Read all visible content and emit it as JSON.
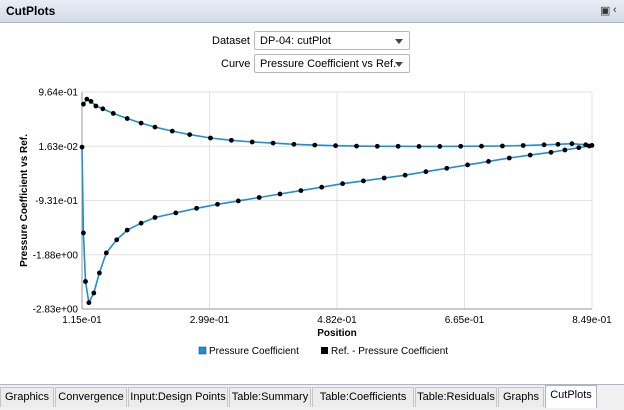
{
  "window": {
    "title": "CutPlots"
  },
  "controls": {
    "dataset_label": "Dataset",
    "dataset_value": "DP-04: cutPlot",
    "curve_label": "Curve",
    "curve_value": "Pressure Coefficient vs Ref."
  },
  "tabs": [
    {
      "label": "Graphics"
    },
    {
      "label": "Convergence"
    },
    {
      "label": "Input:Design Points"
    },
    {
      "label": "Table:Summary"
    },
    {
      "label": "Table:Coefficients"
    },
    {
      "label": "Table:Residuals"
    },
    {
      "label": "Graphs"
    },
    {
      "label": "CutPlots",
      "active": true
    }
  ],
  "chart_data": {
    "type": "line",
    "xlabel": "Position",
    "ylabel": "Pressure Coefficient vs Ref.",
    "xlim": [
      0.115,
      0.849
    ],
    "ylim": [
      -2.83,
      0.964
    ],
    "x_ticks": [
      "1.15e-01",
      "2.99e-01",
      "4.82e-01",
      "6.65e-01",
      "8.49e-01"
    ],
    "y_ticks": [
      "9.64e-01",
      "1.63e-02",
      "-9.31e-01",
      "-1.88e+00",
      "-2.83e+00"
    ],
    "grid": true,
    "legend_position": "bottom",
    "series": [
      {
        "name": "Pressure Coefficient",
        "color": "#1e8fd0",
        "style": "line",
        "x": [
          0.117,
          0.122,
          0.128,
          0.135,
          0.145,
          0.16,
          0.18,
          0.2,
          0.22,
          0.245,
          0.27,
          0.3,
          0.33,
          0.36,
          0.39,
          0.42,
          0.45,
          0.48,
          0.51,
          0.54,
          0.57,
          0.6,
          0.63,
          0.66,
          0.69,
          0.72,
          0.75,
          0.78,
          0.8,
          0.82,
          0.84,
          0.849,
          0.845,
          0.83,
          0.81,
          0.79,
          0.76,
          0.73,
          0.7,
          0.67,
          0.64,
          0.61,
          0.58,
          0.55,
          0.52,
          0.49,
          0.46,
          0.43,
          0.4,
          0.37,
          0.34,
          0.31,
          0.28,
          0.25,
          0.22,
          0.2,
          0.18,
          0.165,
          0.15,
          0.14,
          0.132,
          0.125,
          0.12,
          0.117,
          0.115
        ],
        "y": [
          0.75,
          0.84,
          0.8,
          0.72,
          0.67,
          0.59,
          0.5,
          0.42,
          0.35,
          0.28,
          0.22,
          0.16,
          0.12,
          0.09,
          0.07,
          0.05,
          0.035,
          0.025,
          0.018,
          0.015,
          0.014,
          0.013,
          0.013,
          0.014,
          0.016,
          0.02,
          0.028,
          0.04,
          0.05,
          0.06,
          0.04,
          0.03,
          0.02,
          -0.01,
          -0.05,
          -0.09,
          -0.14,
          -0.19,
          -0.25,
          -0.31,
          -0.37,
          -0.43,
          -0.49,
          -0.54,
          -0.59,
          -0.64,
          -0.7,
          -0.76,
          -0.82,
          -0.88,
          -0.94,
          -1.0,
          -1.07,
          -1.15,
          -1.23,
          -1.33,
          -1.45,
          -1.62,
          -1.85,
          -2.2,
          -2.55,
          -2.72,
          -2.35,
          -1.5,
          0.0
        ]
      },
      {
        "name": "Ref. - Pressure Coefficient",
        "color": "#000000",
        "style": "points",
        "x": [
          0.117,
          0.122,
          0.128,
          0.135,
          0.145,
          0.16,
          0.18,
          0.2,
          0.22,
          0.245,
          0.27,
          0.3,
          0.33,
          0.36,
          0.39,
          0.42,
          0.45,
          0.48,
          0.51,
          0.54,
          0.57,
          0.6,
          0.63,
          0.66,
          0.69,
          0.72,
          0.75,
          0.78,
          0.8,
          0.82,
          0.84,
          0.849,
          0.845,
          0.83,
          0.81,
          0.79,
          0.76,
          0.73,
          0.7,
          0.67,
          0.64,
          0.61,
          0.58,
          0.55,
          0.52,
          0.49,
          0.46,
          0.43,
          0.4,
          0.37,
          0.34,
          0.31,
          0.28,
          0.25,
          0.22,
          0.2,
          0.18,
          0.165,
          0.15,
          0.14,
          0.132,
          0.125,
          0.12,
          0.117,
          0.115
        ],
        "y": [
          0.75,
          0.84,
          0.8,
          0.72,
          0.67,
          0.59,
          0.5,
          0.42,
          0.35,
          0.28,
          0.22,
          0.16,
          0.12,
          0.09,
          0.07,
          0.05,
          0.035,
          0.025,
          0.018,
          0.015,
          0.014,
          0.013,
          0.013,
          0.014,
          0.016,
          0.02,
          0.028,
          0.04,
          0.05,
          0.06,
          0.04,
          0.03,
          0.02,
          -0.01,
          -0.05,
          -0.09,
          -0.14,
          -0.19,
          -0.25,
          -0.31,
          -0.37,
          -0.43,
          -0.49,
          -0.54,
          -0.59,
          -0.64,
          -0.7,
          -0.76,
          -0.82,
          -0.88,
          -0.94,
          -1.0,
          -1.07,
          -1.15,
          -1.23,
          -1.33,
          -1.45,
          -1.62,
          -1.85,
          -2.2,
          -2.55,
          -2.72,
          -2.35,
          -1.5,
          0.0
        ]
      }
    ]
  }
}
